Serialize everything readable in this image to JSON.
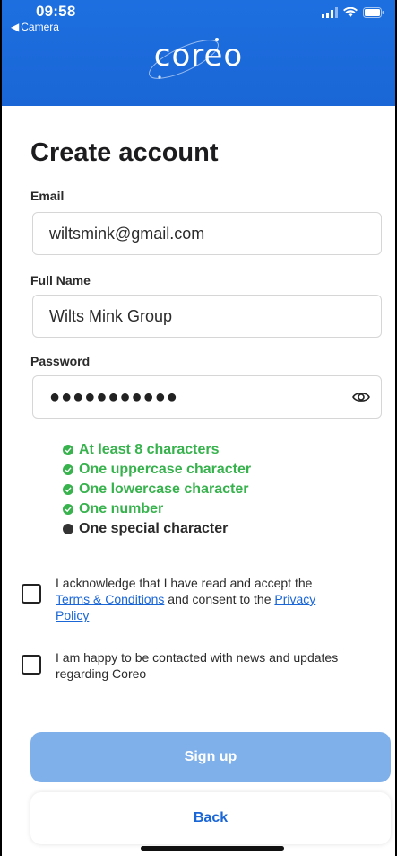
{
  "status_bar": {
    "time": "09:58",
    "back_label": "Camera"
  },
  "header": {
    "logo_text": "coreo"
  },
  "form": {
    "title": "Create account",
    "email": {
      "label": "Email",
      "value": "wiltsmink@gmail.com"
    },
    "full_name": {
      "label": "Full Name",
      "value": "Wilts Mink Group"
    },
    "password": {
      "label": "Password",
      "value": "●●●●●●●●●●●"
    }
  },
  "password_rules": [
    {
      "text": "At least 8 characters",
      "met": true
    },
    {
      "text": "One uppercase character",
      "met": true
    },
    {
      "text": "One lowercase character",
      "met": true
    },
    {
      "text": "One number",
      "met": true
    },
    {
      "text": "One special character",
      "met": false
    }
  ],
  "consent": {
    "terms": {
      "prefix": "I acknowledge that I have read and accept the ",
      "terms_link": "Terms & Conditions",
      "middle": " and consent to the ",
      "privacy_link": "Privacy Policy"
    },
    "news": {
      "text": "I am happy to be contacted with news and updates regarding Coreo"
    }
  },
  "buttons": {
    "sign_up": "Sign up",
    "back": "Back"
  },
  "colors": {
    "brand_blue": "#1a66d6",
    "success_green": "#37b24d",
    "disabled_button": "#7fb0ea"
  }
}
